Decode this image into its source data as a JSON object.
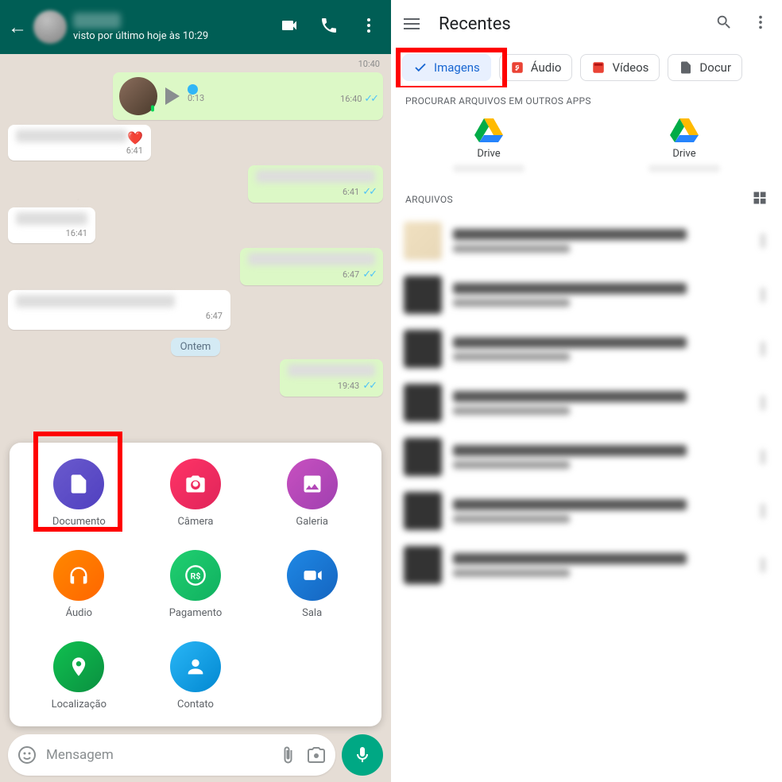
{
  "whatsapp": {
    "header": {
      "status": "visto por último hoje às 10:29"
    },
    "messages": {
      "ts_top": "10:40",
      "audio": {
        "duration": "0:13",
        "time": "16:40"
      },
      "in1_time": "6:41",
      "out1_time": "6:41",
      "in2_time": "16:41",
      "out2_time": "6:47",
      "in3_time": "6:47",
      "date_chip": "Ontem",
      "out3_time": "19:43"
    },
    "attach": {
      "documento": "Documento",
      "camera": "Câmera",
      "galeria": "Galeria",
      "audio": "Áudio",
      "pagamento": "Pagamento",
      "sala": "Sala",
      "localizacao": "Localização",
      "contato": "Contato"
    },
    "input": {
      "placeholder": "Mensagem"
    }
  },
  "filepicker": {
    "title": "Recentes",
    "chips": {
      "imagens": "Imagens",
      "audio": "Áudio",
      "videos": "Vídeos",
      "documentos": "Docur"
    },
    "section_other_apps": "PROCURAR ARQUIVOS EM OUTROS APPS",
    "drive_label": "Drive",
    "section_files": "ARQUIVOS"
  }
}
